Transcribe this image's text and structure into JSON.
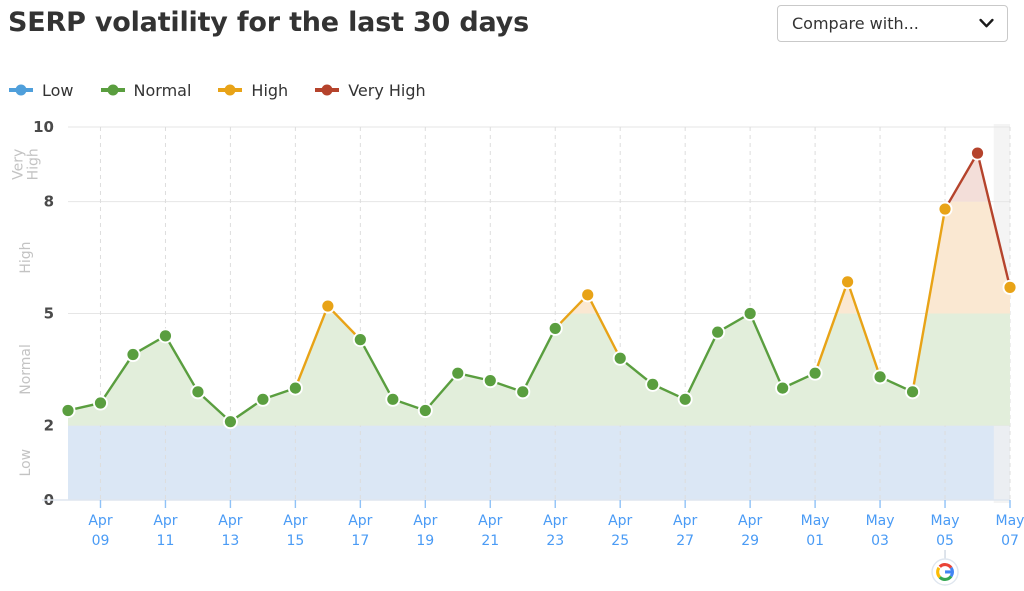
{
  "header": {
    "title": "SERP volatility for the last 30 days",
    "compare_placeholder": "Compare with...",
    "chevron_icon": "chevron-down-icon"
  },
  "legend": {
    "items": [
      {
        "label": "Low",
        "color": "#4f9fdb",
        "key": "low"
      },
      {
        "label": "Normal",
        "color": "#5a9e3f",
        "key": "normal"
      },
      {
        "label": "High",
        "color": "#e8a317",
        "key": "high"
      },
      {
        "label": "Very High",
        "color": "#b5432c",
        "key": "very_high"
      }
    ]
  },
  "footer": {
    "source_icon": "google-logo-icon",
    "source_marker_day": "May 05"
  },
  "chart_data": {
    "type": "line",
    "title": "SERP volatility for the last 30 days",
    "xlabel": "",
    "ylabel": "",
    "ylim": [
      0,
      10
    ],
    "yticks": [
      0,
      2,
      5,
      8,
      10
    ],
    "grid": true,
    "legend_position": "top-left",
    "bands": [
      {
        "name": "Low",
        "from": 0,
        "to": 2,
        "color": "#4f9fdb",
        "fill": "#dbe7f5"
      },
      {
        "name": "Normal",
        "from": 2,
        "to": 5,
        "color": "#5a9e3f",
        "fill": "#e2eedb"
      },
      {
        "name": "High",
        "from": 5,
        "to": 8,
        "color": "#e8a317",
        "fill": "#fae8d2"
      },
      {
        "name": "Very High",
        "from": 8,
        "to": 10,
        "color": "#b5432c",
        "fill": "#f3ded9"
      }
    ],
    "band_label_text": [
      "Low",
      "Normal",
      "High",
      "Very High"
    ],
    "x": [
      "Apr 08",
      "Apr 09",
      "Apr 10",
      "Apr 11",
      "Apr 12",
      "Apr 13",
      "Apr 14",
      "Apr 15",
      "Apr 16",
      "Apr 17",
      "Apr 18",
      "Apr 19",
      "Apr 20",
      "Apr 21",
      "Apr 22",
      "Apr 23",
      "Apr 24",
      "Apr 25",
      "Apr 26",
      "Apr 27",
      "Apr 28",
      "Apr 29",
      "Apr 30",
      "May 01",
      "May 02",
      "May 03",
      "May 04",
      "May 05",
      "May 06",
      "May 07"
    ],
    "tick_labels": [
      {
        "line1": "Apr",
        "line2": "09",
        "index": 1
      },
      {
        "line1": "Apr",
        "line2": "11",
        "index": 3
      },
      {
        "line1": "Apr",
        "line2": "13",
        "index": 5
      },
      {
        "line1": "Apr",
        "line2": "15",
        "index": 7
      },
      {
        "line1": "Apr",
        "line2": "17",
        "index": 9
      },
      {
        "line1": "Apr",
        "line2": "19",
        "index": 11
      },
      {
        "line1": "Apr",
        "line2": "21",
        "index": 13
      },
      {
        "line1": "Apr",
        "line2": "23",
        "index": 15
      },
      {
        "line1": "Apr",
        "line2": "25",
        "index": 17
      },
      {
        "line1": "Apr",
        "line2": "27",
        "index": 19
      },
      {
        "line1": "Apr",
        "line2": "29",
        "index": 21
      },
      {
        "line1": "May",
        "line2": "01",
        "index": 23
      },
      {
        "line1": "May",
        "line2": "03",
        "index": 25
      },
      {
        "line1": "May",
        "line2": "05",
        "index": 27
      },
      {
        "line1": "May",
        "line2": "07",
        "index": 29
      }
    ],
    "values": [
      2.4,
      2.6,
      3.9,
      4.4,
      2.9,
      2.1,
      2.7,
      3.0,
      5.2,
      4.3,
      2.7,
      2.4,
      3.4,
      3.2,
      2.9,
      4.6,
      5.5,
      3.8,
      3.1,
      2.7,
      4.5,
      5.0,
      3.0,
      3.4,
      5.85,
      3.3,
      2.9,
      7.8,
      9.3,
      5.7
    ],
    "point_levels": [
      "normal",
      "normal",
      "normal",
      "normal",
      "normal",
      "normal",
      "normal",
      "normal",
      "high",
      "normal",
      "normal",
      "normal",
      "normal",
      "normal",
      "normal",
      "normal",
      "high",
      "normal",
      "normal",
      "normal",
      "normal",
      "normal",
      "normal",
      "normal",
      "high",
      "normal",
      "normal",
      "high",
      "very_high",
      "high"
    ],
    "highlight_region": {
      "from_index": 28,
      "to_index": 29,
      "color": "#f0f0f0"
    }
  }
}
